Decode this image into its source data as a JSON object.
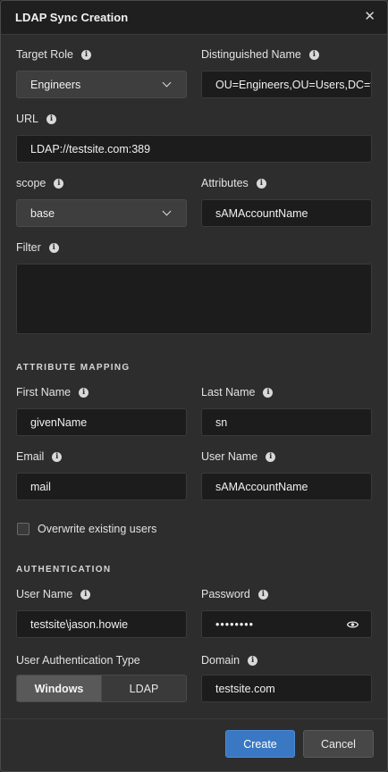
{
  "dialog": {
    "title": "LDAP Sync Creation",
    "close_glyph": "✕"
  },
  "fields": {
    "target_role": {
      "label": "Target Role",
      "value": "Engineers"
    },
    "distinguished_name": {
      "label": "Distinguished Name",
      "value": "OU=Engineers,OU=Users,DC=testsite,DC=com"
    },
    "url": {
      "label": "URL",
      "value": "LDAP://testsite.com:389"
    },
    "scope": {
      "label": "scope",
      "value": "base"
    },
    "attributes": {
      "label": "Attributes",
      "value": "sAMAccountName"
    },
    "filter": {
      "label": "Filter",
      "value": ""
    }
  },
  "attribute_mapping": {
    "heading": "ATTRIBUTE MAPPING",
    "first_name": {
      "label": "First Name",
      "value": "givenName"
    },
    "last_name": {
      "label": "Last Name",
      "value": "sn"
    },
    "email": {
      "label": "Email",
      "value": "mail"
    },
    "user_name": {
      "label": "User Name",
      "value": "sAMAccountName"
    },
    "overwrite": {
      "label": "Overwrite existing users",
      "checked": false
    }
  },
  "authentication": {
    "heading": "AUTHENTICATION",
    "user_name": {
      "label": "User Name",
      "value": "testsite\\jason.howie"
    },
    "password": {
      "label": "Password",
      "value": "••••••••"
    },
    "auth_type": {
      "label": "User Authentication Type",
      "options": [
        "Windows",
        "LDAP"
      ],
      "selected": "Windows"
    },
    "domain": {
      "label": "Domain",
      "value": "testsite.com"
    }
  },
  "buttons": {
    "create": "Create",
    "cancel": "Cancel"
  },
  "info_glyph": "i",
  "colors": {
    "primary": "#3a78c3",
    "background": "#2d2d2d",
    "input_bg": "#1c1c1c"
  }
}
